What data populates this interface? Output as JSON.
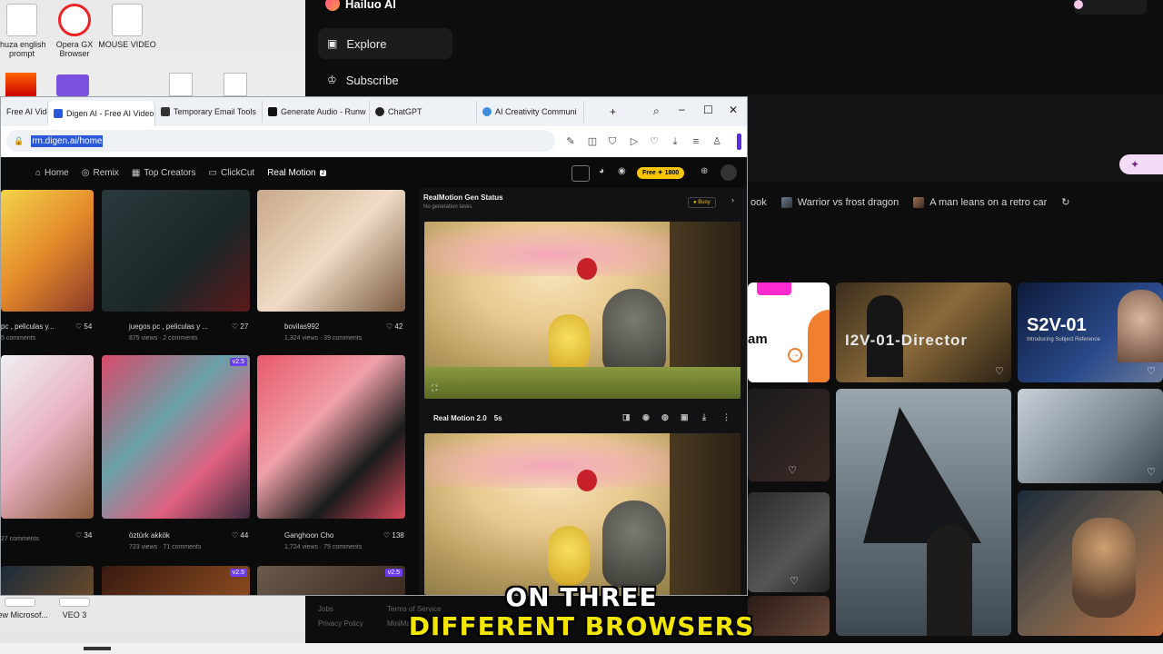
{
  "desktop": {
    "icons": [
      {
        "label": "thuza english prompt"
      },
      {
        "label": "Opera GX Browser"
      },
      {
        "label": "MOUSE VIDEO"
      },
      {
        "label": "New Microsof..."
      },
      {
        "label": "VEO 3"
      }
    ]
  },
  "hailuo": {
    "brand": "Hailuo AI",
    "nav": [
      {
        "label": "Explore"
      },
      {
        "label": "Subscribe"
      }
    ],
    "chips": [
      "ook",
      "Warrior vs frost dragon",
      "A man leans on a retro car"
    ],
    "cards": {
      "i2v_text": "I2V-01-Director",
      "s2v_title": "S2V-01",
      "s2v_sub": "Introducing Subject Reference",
      "partial_text": "am"
    },
    "footer": [
      "Jobs",
      "Terms of Service",
      "Privacy Policy",
      "MiniMax"
    ]
  },
  "browser": {
    "tabs": [
      {
        "label": "Free AI Vide",
        "color": "#6a5acd"
      },
      {
        "label": "Digen AI - Free AI Video",
        "color": "#2b57d9"
      },
      {
        "label": "Temporary Email Tools",
        "color": "#333333"
      },
      {
        "label": "Generate Audio - Runw",
        "color": "#111111"
      },
      {
        "label": "ChatGPT",
        "color": "#222222"
      },
      {
        "label": "AI Creativity Communi",
        "color": "#3c8dde"
      }
    ],
    "url": "rm.digen.ai/home",
    "site": {
      "nav": [
        "Home",
        "Remix",
        "Top Creators",
        "ClickCut",
        "Real Motion"
      ],
      "realmotion_badge": "2",
      "free_badge": "Free",
      "credits": "1800",
      "posts": [
        {
          "title": "pc , peliculas y...",
          "stats": "5 comments",
          "likes": "54"
        },
        {
          "title": "juegos pc , peliculas y ...",
          "stats": "875 views · 2 comments",
          "likes": "27"
        },
        {
          "title": "bovilas992",
          "stats": "1,324 views · 39 comments",
          "likes": "42"
        },
        {
          "title": "",
          "stats": "27 comments",
          "likes": "34"
        },
        {
          "title": "öztürk akkök",
          "stats": "723 views · 71 comments",
          "likes": "44"
        },
        {
          "title": "Ganghoon Cho",
          "stats": "1,724 views · 75 comments",
          "likes": "138"
        }
      ],
      "v25_badge": "v2.5",
      "gen_status": {
        "title": "RealMotion Gen Status",
        "sub": "No generation tasks",
        "busy": "Busy"
      },
      "video_bar": {
        "model": "Real Motion 2.0",
        "duration": "5s"
      }
    }
  },
  "caption": {
    "line1": "ON THREE",
    "line2": "DIFFERENT BROWSERS"
  }
}
